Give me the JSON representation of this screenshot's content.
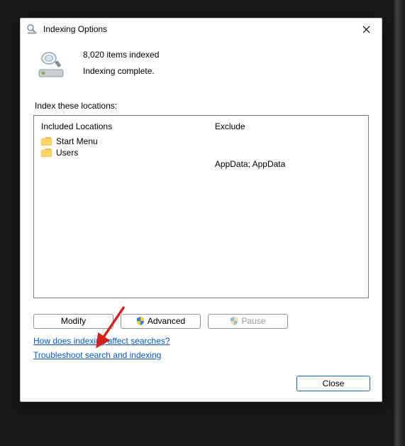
{
  "title": "Indexing Options",
  "status": {
    "count_line": "8,020 items indexed",
    "state_line": "Indexing complete."
  },
  "section_label": "Index these locations:",
  "columns": {
    "included_header": "Included Locations",
    "included_items": [
      "Start Menu",
      "Users"
    ],
    "exclude_header": "Exclude",
    "exclude_items": [
      "",
      "AppData; AppData"
    ]
  },
  "buttons": {
    "modify": "Modify",
    "advanced": "Advanced",
    "pause": "Pause",
    "close": "Close"
  },
  "links": {
    "how": "How does indexing affect searches?",
    "troubleshoot": "Troubleshoot search and indexing"
  }
}
